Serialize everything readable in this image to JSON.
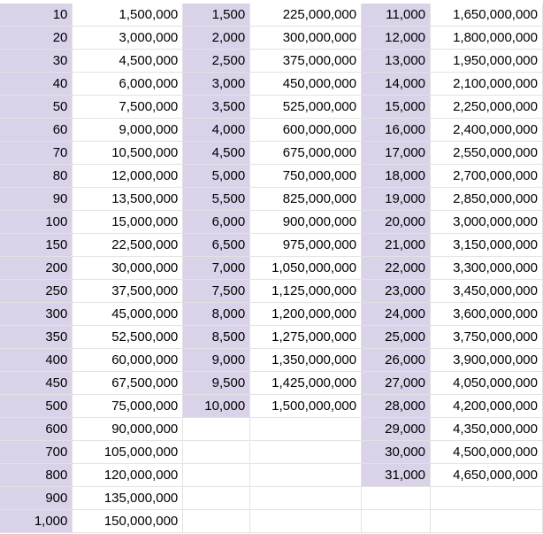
{
  "highlight_color": "#d9d2e9",
  "grid_color": "#e2e2e2",
  "rows": [
    [
      "10",
      "1,500,000",
      "1,500",
      "225,000,000",
      "11,000",
      "1,650,000,000"
    ],
    [
      "20",
      "3,000,000",
      "2,000",
      "300,000,000",
      "12,000",
      "1,800,000,000"
    ],
    [
      "30",
      "4,500,000",
      "2,500",
      "375,000,000",
      "13,000",
      "1,950,000,000"
    ],
    [
      "40",
      "6,000,000",
      "3,000",
      "450,000,000",
      "14,000",
      "2,100,000,000"
    ],
    [
      "50",
      "7,500,000",
      "3,500",
      "525,000,000",
      "15,000",
      "2,250,000,000"
    ],
    [
      "60",
      "9,000,000",
      "4,000",
      "600,000,000",
      "16,000",
      "2,400,000,000"
    ],
    [
      "70",
      "10,500,000",
      "4,500",
      "675,000,000",
      "17,000",
      "2,550,000,000"
    ],
    [
      "80",
      "12,000,000",
      "5,000",
      "750,000,000",
      "18,000",
      "2,700,000,000"
    ],
    [
      "90",
      "13,500,000",
      "5,500",
      "825,000,000",
      "19,000",
      "2,850,000,000"
    ],
    [
      "100",
      "15,000,000",
      "6,000",
      "900,000,000",
      "20,000",
      "3,000,000,000"
    ],
    [
      "150",
      "22,500,000",
      "6,500",
      "975,000,000",
      "21,000",
      "3,150,000,000"
    ],
    [
      "200",
      "30,000,000",
      "7,000",
      "1,050,000,000",
      "22,000",
      "3,300,000,000"
    ],
    [
      "250",
      "37,500,000",
      "7,500",
      "1,125,000,000",
      "23,000",
      "3,450,000,000"
    ],
    [
      "300",
      "45,000,000",
      "8,000",
      "1,200,000,000",
      "24,000",
      "3,600,000,000"
    ],
    [
      "350",
      "52,500,000",
      "8,500",
      "1,275,000,000",
      "25,000",
      "3,750,000,000"
    ],
    [
      "400",
      "60,000,000",
      "9,000",
      "1,350,000,000",
      "26,000",
      "3,900,000,000"
    ],
    [
      "450",
      "67,500,000",
      "9,500",
      "1,425,000,000",
      "27,000",
      "4,050,000,000"
    ],
    [
      "500",
      "75,000,000",
      "10,000",
      "1,500,000,000",
      "28,000",
      "4,200,000,000"
    ],
    [
      "600",
      "90,000,000",
      "",
      "",
      "29,000",
      "4,350,000,000"
    ],
    [
      "700",
      "105,000,000",
      "",
      "",
      "30,000",
      "4,500,000,000"
    ],
    [
      "800",
      "120,000,000",
      "",
      "",
      "31,000",
      "4,650,000,000"
    ],
    [
      "900",
      "135,000,000",
      "",
      "",
      "",
      ""
    ],
    [
      "1,000",
      "150,000,000",
      "",
      "",
      "",
      ""
    ]
  ]
}
